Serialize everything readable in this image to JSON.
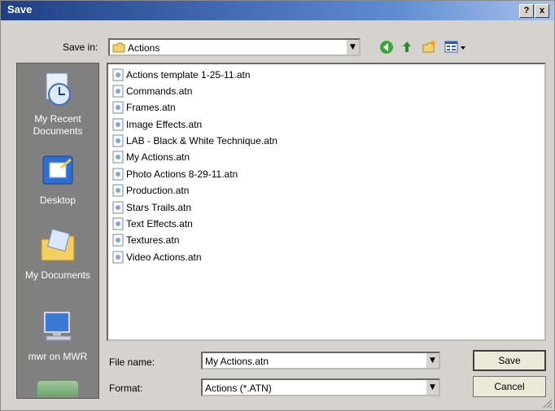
{
  "window": {
    "title": "Save",
    "help_label": "?",
    "close_label": "x"
  },
  "toolbar": {
    "save_in_label": "Save in:",
    "location": "Actions",
    "icons": [
      "back-icon",
      "up-folder-icon",
      "new-folder-icon",
      "view-menu-icon"
    ]
  },
  "places": [
    {
      "label": "My Recent\nDocuments",
      "icon": "recent-documents-icon"
    },
    {
      "label": "Desktop",
      "icon": "desktop-icon"
    },
    {
      "label": "My Documents",
      "icon": "my-documents-icon"
    },
    {
      "label": "mwr on MWR",
      "icon": "my-computer-icon"
    }
  ],
  "files": [
    "Actions template 1-25-11.atn",
    "Commands.atn",
    "Frames.atn",
    "Image Effects.atn",
    "LAB - Black & White Technique.atn",
    "My Actions.atn",
    "Photo Actions 8-29-11.atn",
    "Production.atn",
    "Stars Trails.atn",
    "Text Effects.atn",
    "Textures.atn",
    "Video Actions.atn"
  ],
  "form": {
    "file_name_label": "File name:",
    "file_name_value": "My Actions.atn",
    "format_label": "Format:",
    "format_value": "Actions (*.ATN)"
  },
  "buttons": {
    "save": "Save",
    "cancel": "Cancel"
  },
  "colors": {
    "title_bar": "#1f3f86",
    "places_bar": "#808080",
    "dialog": "#d6d3ce"
  }
}
